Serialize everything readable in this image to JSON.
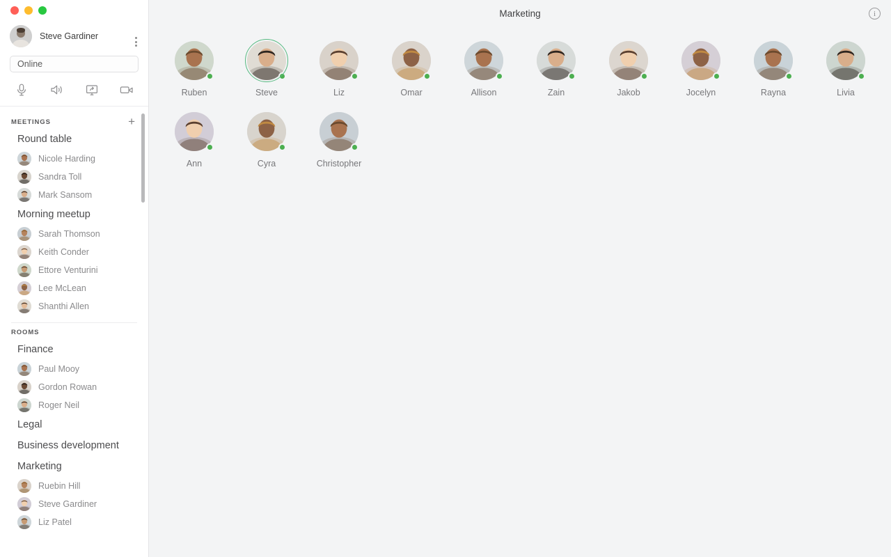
{
  "window": {
    "traffic_lights": [
      "close",
      "minimize",
      "zoom"
    ]
  },
  "profile": {
    "name": "Steve Gardiner",
    "status_value": "Online",
    "menu_icon": "kebab-menu-icon",
    "controls": [
      {
        "name": "microphone-icon",
        "label": "Microphone"
      },
      {
        "name": "speaker-icon",
        "label": "Speaker"
      },
      {
        "name": "screen-share-icon",
        "label": "Share screen"
      },
      {
        "name": "video-camera-icon",
        "label": "Video"
      }
    ]
  },
  "sidebar": {
    "sections": [
      {
        "label": "MEETINGS",
        "add_label": "+",
        "groups": [
          {
            "title": "Round table",
            "members": [
              "Nicole Harding",
              "Sandra Toll",
              "Mark Sansom"
            ]
          },
          {
            "title": "Morning meetup",
            "members": [
              "Sarah Thomson",
              "Keith Conder",
              "Ettore Venturini",
              "Lee McLean",
              "Shanthi Allen"
            ]
          }
        ]
      },
      {
        "label": "ROOMS",
        "add_label": "",
        "groups": [
          {
            "title": "Finance",
            "members": [
              "Paul Mooy",
              "Gordon Rowan",
              "Roger Neil"
            ]
          },
          {
            "title": "Legal",
            "members": []
          },
          {
            "title": "Business development",
            "members": []
          },
          {
            "title": "Marketing",
            "members": [
              "Ruebin Hill",
              "Steve Gardiner",
              "Liz Patel"
            ]
          }
        ]
      }
    ]
  },
  "main": {
    "title": "Marketing",
    "info_icon": "info-icon",
    "participants": [
      {
        "name": "Ruben",
        "online": true,
        "active": false
      },
      {
        "name": "Steve",
        "online": true,
        "active": true
      },
      {
        "name": "Liz",
        "online": true,
        "active": false
      },
      {
        "name": "Omar",
        "online": true,
        "active": false
      },
      {
        "name": "Allison",
        "online": true,
        "active": false
      },
      {
        "name": "Zain",
        "online": true,
        "active": false
      },
      {
        "name": "Jakob",
        "online": true,
        "active": false
      },
      {
        "name": "Jocelyn",
        "online": true,
        "active": false
      },
      {
        "name": "Rayna",
        "online": true,
        "active": false
      },
      {
        "name": "Livia",
        "online": true,
        "active": false
      },
      {
        "name": "Ann",
        "online": true,
        "active": false
      },
      {
        "name": "Cyra",
        "online": true,
        "active": false
      },
      {
        "name": "Christopher",
        "online": true,
        "active": false
      }
    ]
  },
  "colors": {
    "sidebar_bg": "#ffffff",
    "main_bg": "#f3f4f5",
    "presence_online": "#4caf50",
    "active_ring": "#56b980",
    "text_primary": "#3c3c3c",
    "text_muted": "#8a8a8c"
  }
}
